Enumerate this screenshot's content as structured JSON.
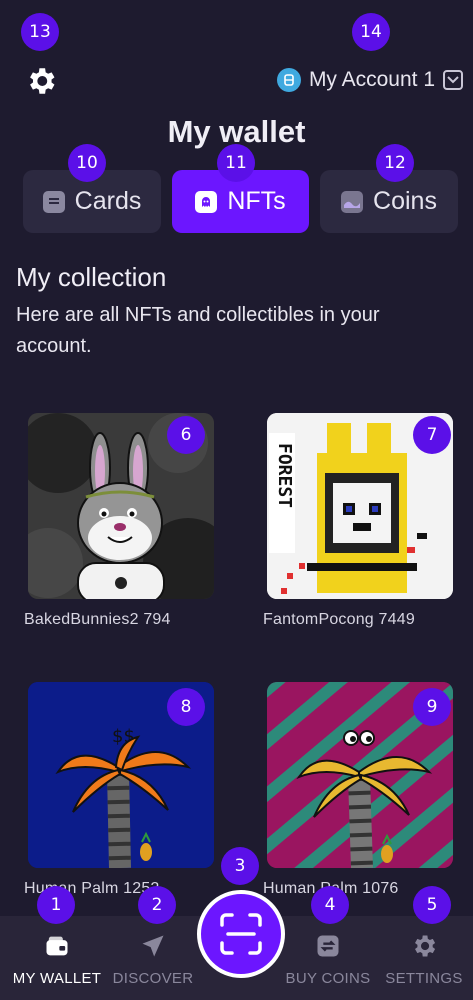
{
  "header": {
    "account_name": "My Account 1",
    "settings_icon": "gear-icon",
    "account_icon": "account-logo-icon",
    "chevron_icon": "chevron-down-icon"
  },
  "page": {
    "title": "My wallet"
  },
  "tabs": [
    {
      "label": "Cards",
      "icon": "card-icon",
      "active": false
    },
    {
      "label": "NFTs",
      "icon": "ghost-icon",
      "active": true
    },
    {
      "label": "Coins",
      "icon": "coins-icon",
      "active": false
    }
  ],
  "collection": {
    "title": "My collection",
    "description": "Here are all NFTs and collectibles in your account."
  },
  "nfts": [
    {
      "name": "BakedBunnies2 794"
    },
    {
      "name": "FantomPocong 7449"
    },
    {
      "name": "Human Palm 1252"
    },
    {
      "name": "Human Palm 1076"
    }
  ],
  "nav": [
    {
      "label": "MY WALLET",
      "icon": "wallet-icon",
      "active": true
    },
    {
      "label": "DISCOVER",
      "icon": "paper-plane-icon",
      "active": false
    },
    {
      "label": "BUY COINS",
      "icon": "exchange-icon",
      "active": false
    },
    {
      "label": "SETTINGS",
      "icon": "gear-icon",
      "active": false
    }
  ],
  "badges": [
    "1",
    "2",
    "3",
    "4",
    "5",
    "6",
    "7",
    "8",
    "9",
    "10",
    "11",
    "12",
    "13",
    "14"
  ],
  "colors": {
    "accent": "#6c16ff",
    "background": "#1e1b2f",
    "badge": "#5b10e8",
    "surface": "#2c2940"
  }
}
